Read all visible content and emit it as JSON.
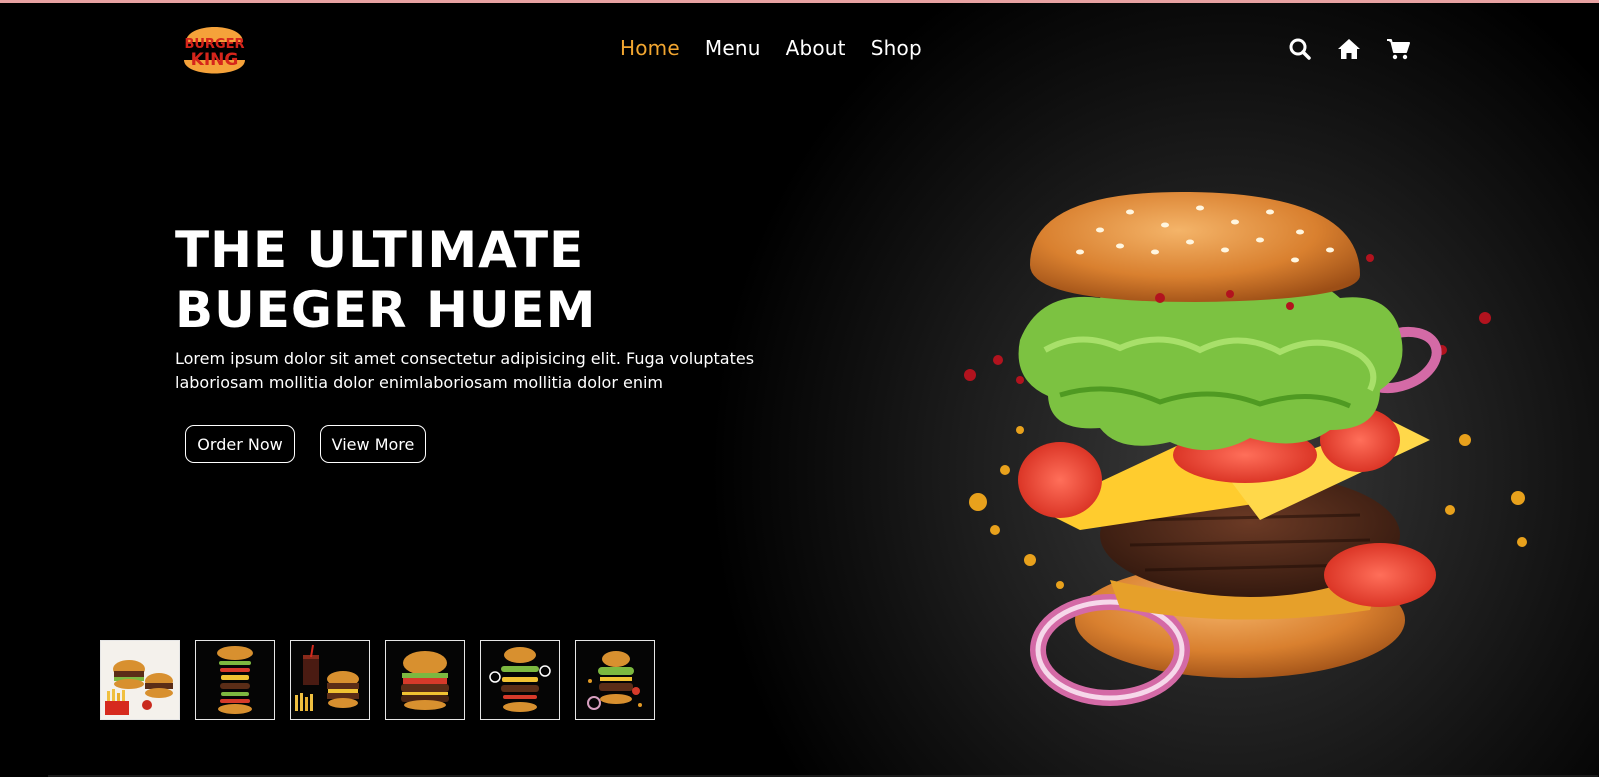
{
  "brand": {
    "logo_text_line1": "BURGER",
    "logo_text_line2": "KING"
  },
  "nav": {
    "items": [
      {
        "label": "Home",
        "active": true
      },
      {
        "label": "Menu",
        "active": false
      },
      {
        "label": "About",
        "active": false
      },
      {
        "label": "Shop",
        "active": false
      }
    ]
  },
  "header_icons": [
    "search-icon",
    "home-icon",
    "cart-icon"
  ],
  "hero": {
    "title_line1": "THE ULTIMATE",
    "title_line2": "BUEGER HUEM",
    "description": "Lorem ipsum dolor sit amet consectetur adipisicing elit. Fuga voluptates laboriosam mollitia dolor enimlaboriosam mollitia dolor enim",
    "primary_button": "Order Now",
    "secondary_button": "View More"
  },
  "thumbnails": [
    "burger-fries-meal",
    "stacked-floating-burger",
    "burger-drink-fries-combo",
    "double-cheeseburger",
    "exploding-burger",
    "burger-with-onions"
  ],
  "colors": {
    "accent": "#f2a630",
    "background": "#000000",
    "text": "#ffffff",
    "top_strip": "#e8a2a2"
  }
}
